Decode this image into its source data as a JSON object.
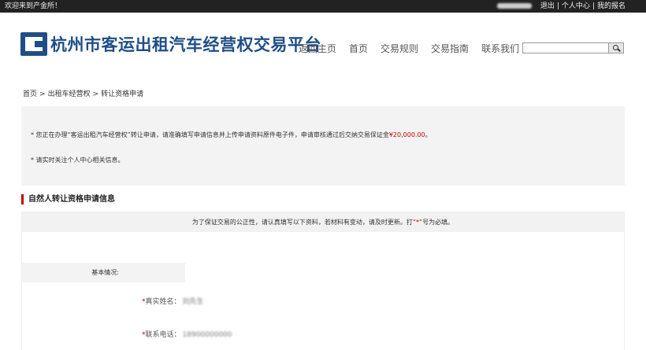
{
  "topbar": {
    "welcome": "欢迎来到产金所！",
    "user": "",
    "logout": "退出",
    "user_center": "个人中心",
    "my_signup": "我的报名"
  },
  "header": {
    "title": "杭州市客运出租汽车经营权交易平台",
    "brand_color": "#1f4e87",
    "nav": [
      "返回主页",
      "首页",
      "交易规则",
      "交易指南",
      "联系我们"
    ],
    "search": {
      "value": "",
      "placeholder": "",
      "icon": "search-icon"
    }
  },
  "breadcrumb": [
    "首页",
    "出租车经营权",
    "转让资格申请"
  ],
  "notice": {
    "line1_prefix": "* 您正在办理“客运出租汽车经营权”转让申请，请准确填写申请信息并上传申请资料原件电子件，申请审核通过后交纳交易保证金",
    "amount": "¥20,000.00",
    "line1_suffix": "。",
    "line2": "* 请实时关注个人中心相关信息。"
  },
  "section": {
    "title": "自然人转让资格申请信息",
    "tip_prefix": "为了保证交易的公正性，请认真填写以下资料，若材料有变动，请及时更新。打",
    "tip_required": "“*”",
    "tip_suffix": "号为必填。",
    "basic_label": "基本情况:",
    "fields": [
      {
        "label": "真实姓名：",
        "value": "刘先生"
      },
      {
        "label": "联系电话：",
        "value": "18900000000"
      }
    ]
  },
  "colors": {
    "accent_red": "#c00000",
    "topbar_bg": "#222222"
  }
}
